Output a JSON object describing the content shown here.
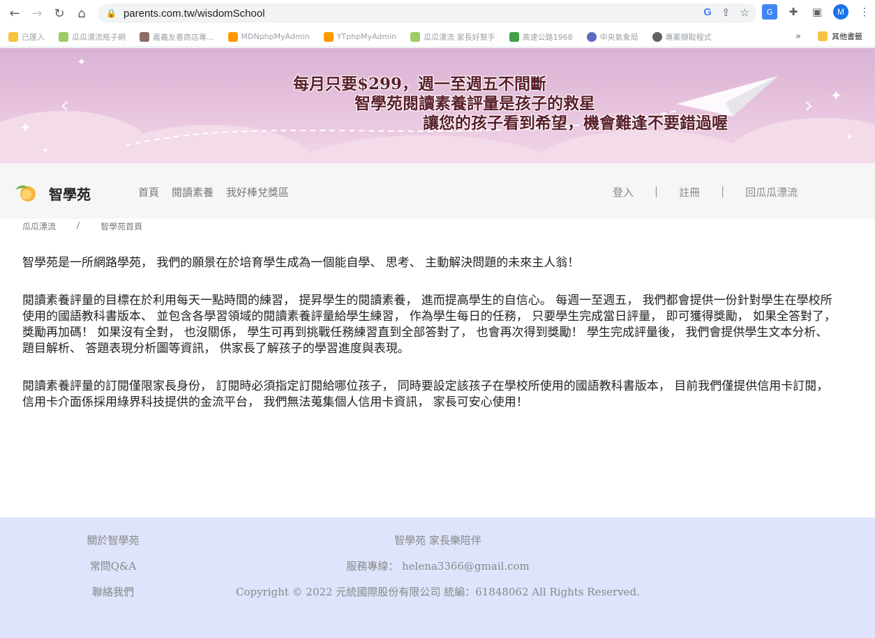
{
  "browser": {
    "url": "parents.com.tw/wisdomSchool",
    "avatar_letter": "M",
    "bookmarks": [
      {
        "label": "已匯入",
        "color": "#f5c242"
      },
      {
        "label": "瓜瓜漂流瓶子網",
        "color": "#9ccc65"
      },
      {
        "label": "嘉義友善商店專...",
        "color": "#8d6e63"
      },
      {
        "label": "MDNphpMyAdmin",
        "color": "#ff9800"
      },
      {
        "label": "YTphpMyAdmin",
        "color": "#ff9800"
      },
      {
        "label": "瓜瓜漂流 家長好幫手",
        "color": "#9ccc65"
      },
      {
        "label": "高速公路1968",
        "color": "#43a047"
      },
      {
        "label": "中央氣象局",
        "color": "#5c6bc0"
      },
      {
        "label": "專案擷取程式",
        "color": "#616161"
      }
    ],
    "bookmarks_more": "»",
    "other_bookmarks": "其他書籤"
  },
  "banner": {
    "line1": "每月只要$299，週一至週五不間斷",
    "line2": "智學苑閱讀素養評量是孩子的救星",
    "line3": "讓您的孩子看到希望，機會難逢不要錯過喔"
  },
  "header": {
    "site_name": "智學苑",
    "nav": [
      "首頁",
      "閱讀素養",
      "我好棒兌獎區"
    ],
    "login": "登入",
    "register": "註冊",
    "back": "回瓜瓜漂流",
    "separator": "|"
  },
  "breadcrumb": {
    "home": "瓜瓜漂流",
    "slash": "/",
    "current": "智學苑首頁"
  },
  "content": {
    "p1": "智學苑是一所網路學苑， 我們的願景在於培育學生成為一個能自學、 思考、 主動解決問題的未來主人翁！",
    "p2": "閱讀素養評量的目標在於利用每天一點時間的練習， 提昇學生的閱讀素養， 進而提高學生的自信心。 每週一至週五， 我們都會提供一份針對學生在學校所使用的國語教科書版本、 並包含各學習領域的閱讀素養評量給學生練習， 作為學生每日的任務， 只要學生完成當日評量， 即可獲得獎勵， 如果全答對了， 獎勵再加碼！ 如果沒有全對， 也沒關係， 學生可再到挑戰任務練習直到全部答對了， 也會再次得到獎勵！ 學生完成評量後， 我們會提供學生文本分析、 題目解析、 答題表現分析圖等資訊， 供家長了解孩子的學習進度與表現。",
    "p3": "閱讀素養評量的訂閱僅限家長身份， 訂閱時必須指定訂閱給哪位孩子， 同時要設定該孩子在學校所使用的國語教科書版本， 目前我們僅提供信用卡訂閱， 信用卡介面係採用綠界科技提供的金流平台， 我們無法蒐集個人信用卡資訊， 家長可安心使用！"
  },
  "footer": {
    "links": [
      "關於智學苑",
      "常問Q&A",
      "聯絡我們"
    ],
    "slogan": "智學苑 家長樂陪伴",
    "service": "服務專線： helena3366@gmail.com",
    "copyright": "Copyright © 2022 元統國際股份有限公司 統編：61848062 All Rights Reserved."
  }
}
